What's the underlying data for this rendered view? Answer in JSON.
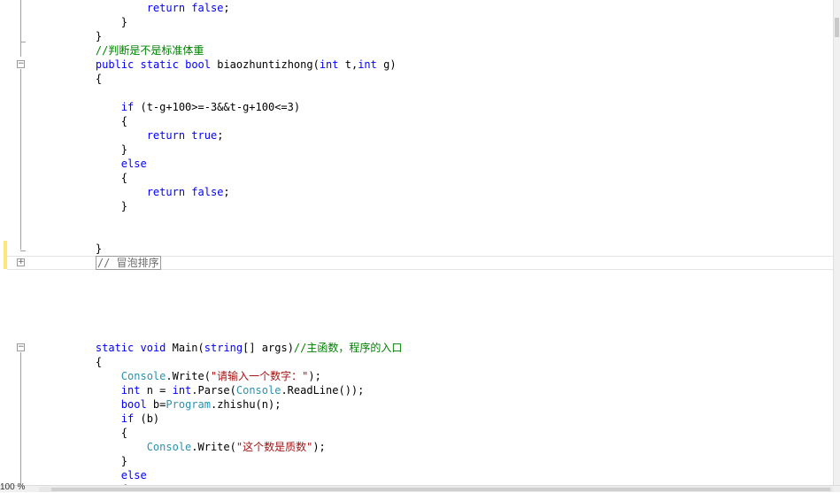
{
  "editor": {
    "zoom": "100 %",
    "lines": [
      {
        "tokens": [
          {
            "t": "            "
          },
          {
            "t": "return",
            "c": "kw"
          },
          {
            "t": " "
          },
          {
            "t": "false",
            "c": "kw"
          },
          {
            "t": ";"
          }
        ]
      },
      {
        "tokens": [
          {
            "t": "        }"
          }
        ]
      },
      {
        "tokens": [
          {
            "t": "    }"
          }
        ]
      },
      {
        "tokens": [
          {
            "t": "    "
          },
          {
            "t": "//判断是不是标准体重",
            "c": "cm"
          }
        ]
      },
      {
        "tokens": [
          {
            "t": "    "
          },
          {
            "t": "public",
            "c": "kw"
          },
          {
            "t": " "
          },
          {
            "t": "static",
            "c": "kw"
          },
          {
            "t": " "
          },
          {
            "t": "bool",
            "c": "kw"
          },
          {
            "t": " biaozhuntizhong("
          },
          {
            "t": "int",
            "c": "kw"
          },
          {
            "t": " t,"
          },
          {
            "t": "int",
            "c": "kw"
          },
          {
            "t": " g)"
          }
        ]
      },
      {
        "tokens": [
          {
            "t": "    {"
          }
        ]
      },
      {
        "tokens": [
          {
            "t": ""
          }
        ]
      },
      {
        "tokens": [
          {
            "t": "        "
          },
          {
            "t": "if",
            "c": "kw"
          },
          {
            "t": " (t-g+100>=-3&&t-g+100<=3)"
          }
        ]
      },
      {
        "tokens": [
          {
            "t": "        {"
          }
        ]
      },
      {
        "tokens": [
          {
            "t": "            "
          },
          {
            "t": "return",
            "c": "kw"
          },
          {
            "t": " "
          },
          {
            "t": "true",
            "c": "kw"
          },
          {
            "t": ";"
          }
        ]
      },
      {
        "tokens": [
          {
            "t": "        }"
          }
        ]
      },
      {
        "tokens": [
          {
            "t": "        "
          },
          {
            "t": "else",
            "c": "kw"
          }
        ]
      },
      {
        "tokens": [
          {
            "t": "        {"
          }
        ]
      },
      {
        "tokens": [
          {
            "t": "            "
          },
          {
            "t": "return",
            "c": "kw"
          },
          {
            "t": " "
          },
          {
            "t": "false",
            "c": "kw"
          },
          {
            "t": ";"
          }
        ]
      },
      {
        "tokens": [
          {
            "t": "        }"
          }
        ]
      },
      {
        "tokens": [
          {
            "t": ""
          }
        ]
      },
      {
        "tokens": [
          {
            "t": ""
          }
        ]
      },
      {
        "tokens": [
          {
            "t": "    }"
          }
        ]
      },
      {
        "tokens": [
          {
            "t": "    "
          },
          {
            "t": "// 冒泡排序",
            "c": "box"
          }
        ]
      },
      {
        "tokens": [
          {
            "t": ""
          }
        ]
      },
      {
        "tokens": [
          {
            "t": ""
          }
        ]
      },
      {
        "tokens": [
          {
            "t": ""
          }
        ]
      },
      {
        "tokens": [
          {
            "t": ""
          }
        ]
      },
      {
        "tokens": [
          {
            "t": ""
          }
        ]
      },
      {
        "tokens": [
          {
            "t": "    "
          },
          {
            "t": "static",
            "c": "kw"
          },
          {
            "t": " "
          },
          {
            "t": "void",
            "c": "kw"
          },
          {
            "t": " Main("
          },
          {
            "t": "string",
            "c": "kw"
          },
          {
            "t": "[] args)"
          },
          {
            "t": "//主函数，程序的入口",
            "c": "cm"
          }
        ]
      },
      {
        "tokens": [
          {
            "t": "    {"
          }
        ]
      },
      {
        "tokens": [
          {
            "t": "        "
          },
          {
            "t": "Console",
            "c": "ty"
          },
          {
            "t": ".Write("
          },
          {
            "t": "\"请输入一个数字：\"",
            "c": "st"
          },
          {
            "t": ");"
          }
        ]
      },
      {
        "tokens": [
          {
            "t": "        "
          },
          {
            "t": "int",
            "c": "kw"
          },
          {
            "t": " n = "
          },
          {
            "t": "int",
            "c": "kw"
          },
          {
            "t": ".Parse("
          },
          {
            "t": "Console",
            "c": "ty"
          },
          {
            "t": ".ReadLine());"
          }
        ]
      },
      {
        "tokens": [
          {
            "t": "        "
          },
          {
            "t": "bool",
            "c": "kw"
          },
          {
            "t": " b="
          },
          {
            "t": "Program",
            "c": "ty"
          },
          {
            "t": ".zhishu(n);"
          }
        ]
      },
      {
        "tokens": [
          {
            "t": "        "
          },
          {
            "t": "if",
            "c": "kw"
          },
          {
            "t": " (b)"
          }
        ]
      },
      {
        "tokens": [
          {
            "t": "        {"
          }
        ]
      },
      {
        "tokens": [
          {
            "t": "            "
          },
          {
            "t": "Console",
            "c": "ty"
          },
          {
            "t": ".Write("
          },
          {
            "t": "\"这个数是质数\"",
            "c": "st"
          },
          {
            "t": ");"
          }
        ]
      },
      {
        "tokens": [
          {
            "t": "        }"
          }
        ]
      },
      {
        "tokens": [
          {
            "t": "        "
          },
          {
            "t": "else",
            "c": "kw"
          }
        ]
      },
      {
        "tokens": [
          {
            "t": "        {"
          }
        ]
      }
    ]
  }
}
